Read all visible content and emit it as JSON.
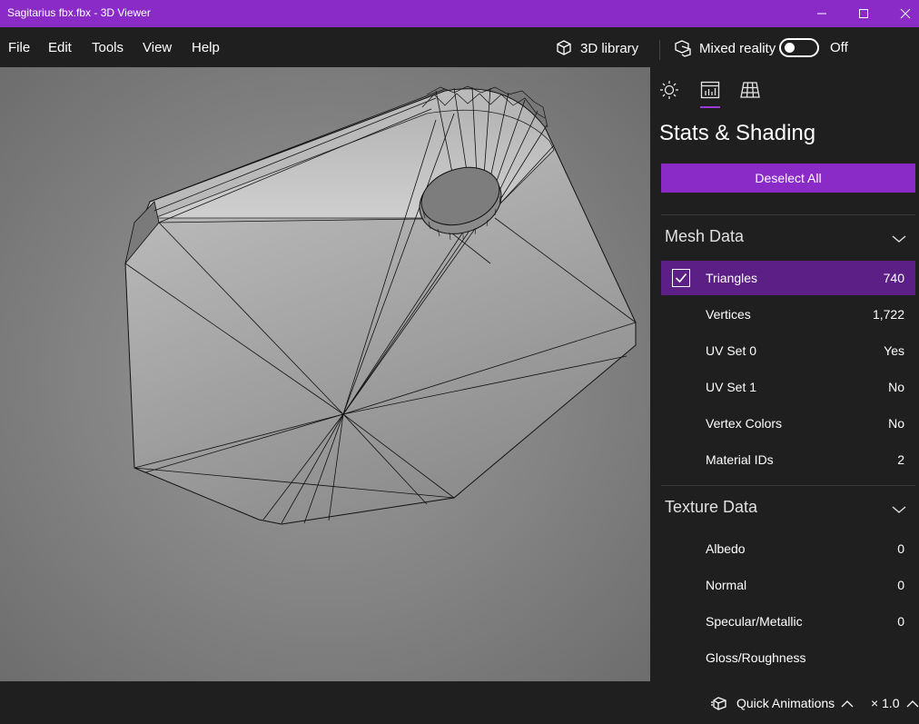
{
  "window": {
    "title": "Sagitarius fbx.fbx - 3D Viewer",
    "accent": "#8a2bc8"
  },
  "menu": {
    "items": [
      "File",
      "Edit",
      "Tools",
      "View",
      "Help"
    ]
  },
  "toolbar": {
    "library_label": "3D library",
    "mixed_reality_label": "Mixed reality",
    "mixed_reality_state": "Off",
    "mixed_reality_on": false
  },
  "panel": {
    "tabs": [
      {
        "icon": "sun-icon"
      },
      {
        "icon": "stats-icon",
        "active": true
      },
      {
        "icon": "grid-icon"
      }
    ],
    "title": "Stats & Shading",
    "deselect_label": "Deselect All",
    "mesh_section": {
      "heading": "Mesh Data",
      "rows": [
        {
          "label": "Triangles",
          "value": "740",
          "checked": true
        },
        {
          "label": "Vertices",
          "value": "1,722"
        },
        {
          "label": "UV Set 0",
          "value": "Yes"
        },
        {
          "label": "UV Set 1",
          "value": "No"
        },
        {
          "label": "Vertex Colors",
          "value": "No"
        },
        {
          "label": "Material IDs",
          "value": "2"
        }
      ]
    },
    "texture_section": {
      "heading": "Texture Data",
      "rows": [
        {
          "label": "Albedo",
          "value": "0"
        },
        {
          "label": "Normal",
          "value": "0"
        },
        {
          "label": "Specular/Metallic",
          "value": "0"
        },
        {
          "label": "Gloss/Roughness",
          "value": ""
        }
      ]
    }
  },
  "bottom": {
    "quick_animations_label": "Quick Animations",
    "speed_label": "× 1.0"
  }
}
